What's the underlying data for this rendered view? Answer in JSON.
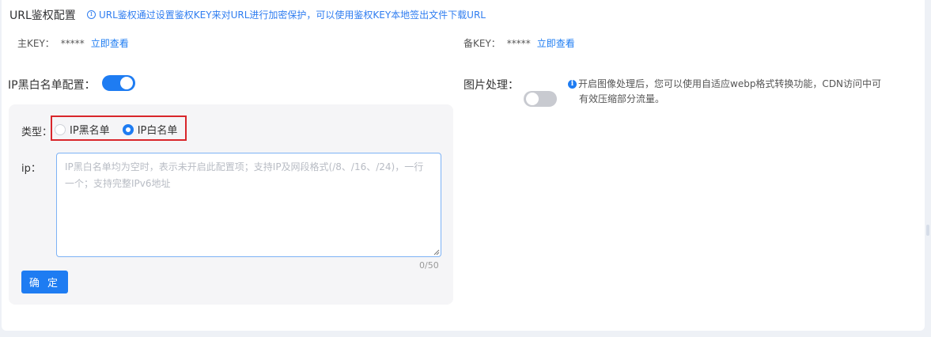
{
  "url_auth": {
    "title": "URL鉴权配置",
    "info": "URL鉴权通过设置鉴权KEY来对URL进行加密保护，可以使用鉴权KEY本地签出文件下载URL",
    "primary_key": {
      "label": "主KEY：",
      "value": "*****",
      "link": "立即查看"
    },
    "backup_key": {
      "label": "备KEY：",
      "value": "*****",
      "link": "立即查看"
    }
  },
  "ip_filter": {
    "label": "IP黑白名单配置：",
    "enabled": true,
    "type_label": "类型：",
    "options": [
      {
        "label": "IP黑名单",
        "checked": false
      },
      {
        "label": "IP白名单",
        "checked": true
      }
    ],
    "ip_label": "ip：",
    "ip_value": "",
    "ip_placeholder": "IP黑白名单均为空时，表示未开启此配置项；支持IP及网段格式(/8、/16、/24)，一行一个；支持完整IPv6地址",
    "counter": "0/50",
    "confirm_label": "确 定"
  },
  "image_processing": {
    "label": "图片处理：",
    "enabled": false,
    "desc_line1": "开启图像处理后，您可以使用自适应webp格式转换功能，CDN访问中可",
    "desc_line2": "有效压缩部分流量。"
  },
  "colors": {
    "primary": "#1e7cf2",
    "highlight_border": "#d9262b",
    "panel_bg": "#f5f5f7"
  }
}
